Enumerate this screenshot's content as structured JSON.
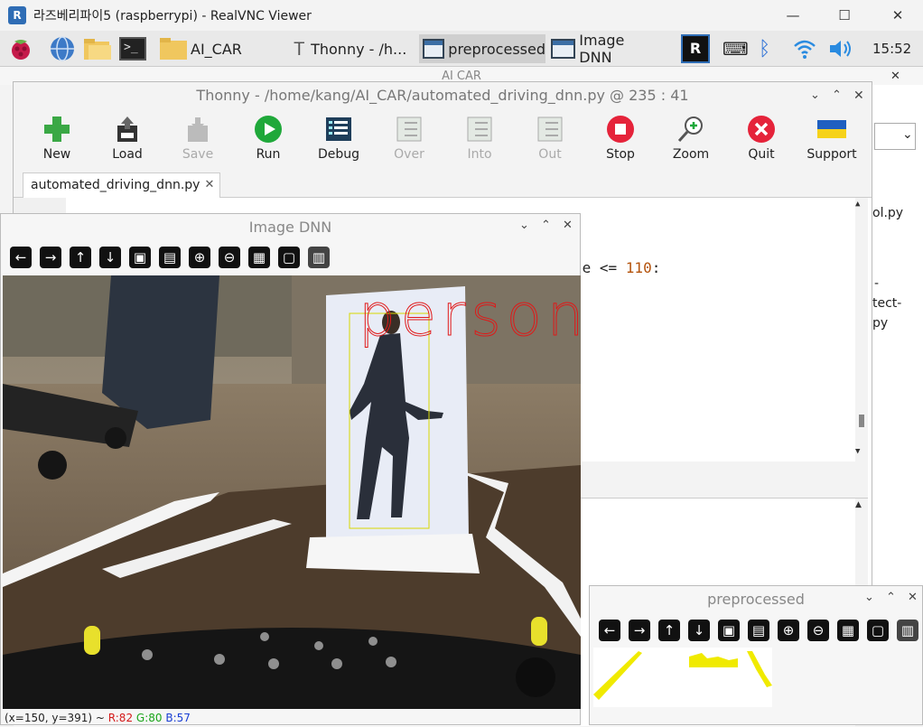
{
  "vnc": {
    "title": "라즈베리파이5 (raspberrypi) - RealVNC Viewer",
    "minimize": "—",
    "maximize": "☐",
    "close": "✕"
  },
  "taskbar": {
    "items": [
      {
        "label": "AI_CAR"
      },
      {
        "label": "Thonny  -  /h..."
      },
      {
        "label": "preprocessed"
      },
      {
        "label": "Image DNN"
      }
    ],
    "clock": "15:52"
  },
  "aicar_title": "AI CAR",
  "thonny": {
    "title": "Thonny  -  /home/kang/AI_CAR/automated_driving_dnn.py  @  235 : 41",
    "tools": [
      {
        "label": "New",
        "icon": "plus-icon",
        "disabled": false
      },
      {
        "label": "Load",
        "icon": "load-icon",
        "disabled": false
      },
      {
        "label": "Save",
        "icon": "save-icon",
        "disabled": true
      },
      {
        "label": "Run",
        "icon": "run-icon",
        "disabled": false
      },
      {
        "label": "Debug",
        "icon": "debug-icon",
        "disabled": false
      },
      {
        "label": "Over",
        "icon": "step-over-icon",
        "disabled": true
      },
      {
        "label": "Into",
        "icon": "step-into-icon",
        "disabled": true
      },
      {
        "label": "Out",
        "icon": "step-out-icon",
        "disabled": true
      },
      {
        "label": "Stop",
        "icon": "stop-icon",
        "disabled": false
      },
      {
        "label": "Zoom",
        "icon": "zoom-icon",
        "disabled": false
      },
      {
        "label": "Quit",
        "icon": "quit-icon",
        "disabled": false
      },
      {
        "label": "Support",
        "icon": "ukraine-flag-icon",
        "disabled": false
      }
    ],
    "tab": "automated_driving_dnn.py",
    "code_fragment_a": "le <= ",
    "code_fragment_num": "110",
    "code_fragment_b": ":"
  },
  "right_panel": {
    "line1": "ol.py",
    "line2": "-",
    "line3": "tect-",
    "line4": "py"
  },
  "image_dnn": {
    "title": "Image DNN",
    "detection_label": "person",
    "status_coords": "(x=150, y=391) ~ ",
    "status_r": "R:82",
    "status_g": "G:80",
    "status_b": "B:57"
  },
  "preprocessed": {
    "title": "preprocessed"
  },
  "colors": {
    "detection_text": "#e01818",
    "bbox": "#d8d800",
    "run_green": "#1fa83a",
    "stop_red": "#e5233a"
  }
}
